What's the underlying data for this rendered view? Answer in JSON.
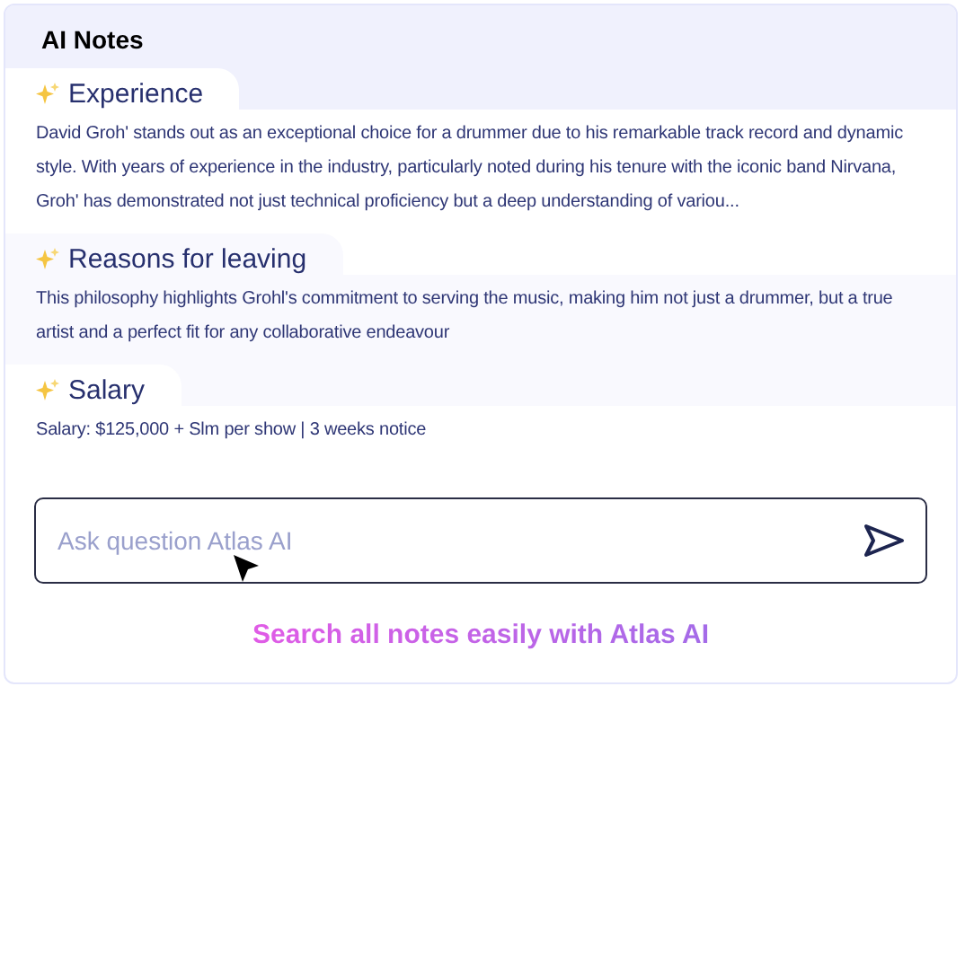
{
  "panel": {
    "title": "AI Notes"
  },
  "sections": [
    {
      "heading": "Experience",
      "text": "David Groh' stands out as an exceptional choice for a drummer due to his remarkable track record and dynamic style. With years of experience in the industry, particularly noted during his tenure with the iconic band Nirvana, Groh' has demonstrated not just technical proficiency but a deep understanding of variou..."
    },
    {
      "heading": "Reasons for leaving",
      "text": "This philosophy highlights Grohl's commitment to serving the music, making him not just a drummer, but a true artist and a perfect fit for any collaborative endeavour"
    },
    {
      "heading": "Salary",
      "text": "Salary: $125,000 + Slm per show | 3 weeks notice"
    }
  ],
  "ask": {
    "placeholder": "Ask question Atlas AI"
  },
  "footer": "Search all notes easily with Atlas AI"
}
